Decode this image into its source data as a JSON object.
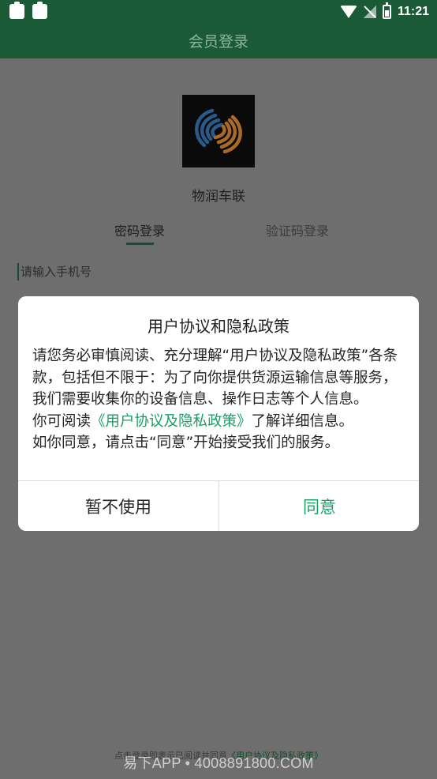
{
  "status_bar": {
    "time": "11:21"
  },
  "header": {
    "title": "会员登录"
  },
  "login": {
    "app_name": "物润车联",
    "tab_password": "密码登录",
    "tab_code": "验证码登录",
    "phone_placeholder": "请输入手机号"
  },
  "dialog": {
    "title": "用户协议和隐私政策",
    "para1": "请您务必审慎阅读、充分理解“用户协议及隐私政策”各条款，包括但不限于：为了向你提供货源运输信息等服务，我们需要收集你的设备信息、操作日志等个人信息。",
    "para2_prefix": "你可阅读",
    "para2_link": "《用户协议及隐私政策》",
    "para2_suffix": "了解详细信息。",
    "para3": "如你同意，请点击“同意”开始接受我们的服务。",
    "decline_label": "暂不使用",
    "agree_label": "同意"
  },
  "footer": {
    "note_prefix": "点击登录即表示已阅读并同意",
    "note_link": "《用户协议及隐私政策》"
  },
  "watermark": "易下APP • 4008891800.COM",
  "colors": {
    "primary": "#1a5a36",
    "link": "#1aa067"
  }
}
